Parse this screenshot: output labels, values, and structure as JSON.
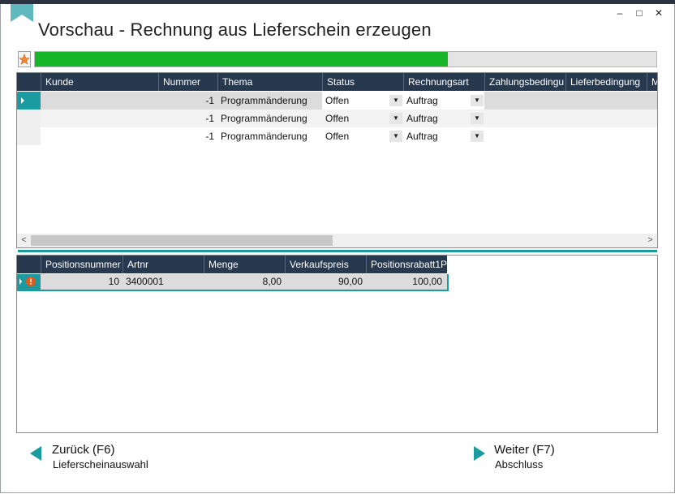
{
  "window": {
    "title": "Vorschau - Rechnung aus Lieferschein erzeugen",
    "minimize": "–",
    "maximize": "□",
    "close": "✕"
  },
  "progress": {
    "value": 0.665,
    "color": "#16b52a"
  },
  "grid1": {
    "columns": [
      "Kunde",
      "Nummer",
      "Thema",
      "Status",
      "Rechnungsart",
      "Zahlungsbedingu",
      "Lieferbedingung",
      "M"
    ],
    "rows": [
      {
        "kunde": "",
        "nummer": "-1",
        "thema": "Programmänderung",
        "status": "Offen",
        "rechnungsart": "Auftrag",
        "zahlung": "",
        "liefer": ""
      },
      {
        "kunde": "",
        "nummer": "-1",
        "thema": "Programmänderung",
        "status": "Offen",
        "rechnungsart": "Auftrag",
        "zahlung": "",
        "liefer": ""
      },
      {
        "kunde": "",
        "nummer": "-1",
        "thema": "Programmänderung",
        "status": "Offen",
        "rechnungsart": "Auftrag",
        "zahlung": "",
        "liefer": ""
      }
    ],
    "scroll_left": "<",
    "scroll_right": ">"
  },
  "grid2": {
    "columns": [
      "Positionsnummer",
      "Artnr",
      "Menge",
      "Verkaufspreis",
      "Positionsrabatt1P"
    ],
    "rows": [
      {
        "pos": "10",
        "artnr": "3400001",
        "menge": "8,00",
        "vk": "90,00",
        "rabatt": "100,00"
      }
    ]
  },
  "nav": {
    "back": {
      "title": "Zurück (F6)",
      "subtitle": "Lieferscheinauswahl"
    },
    "next": {
      "title": "Weiter (F7)",
      "subtitle": "Abschluss"
    }
  },
  "colors": {
    "accent": "#1a9ba0",
    "header": "#27394e",
    "progress": "#16b52a",
    "warning": "#e05a1c"
  }
}
